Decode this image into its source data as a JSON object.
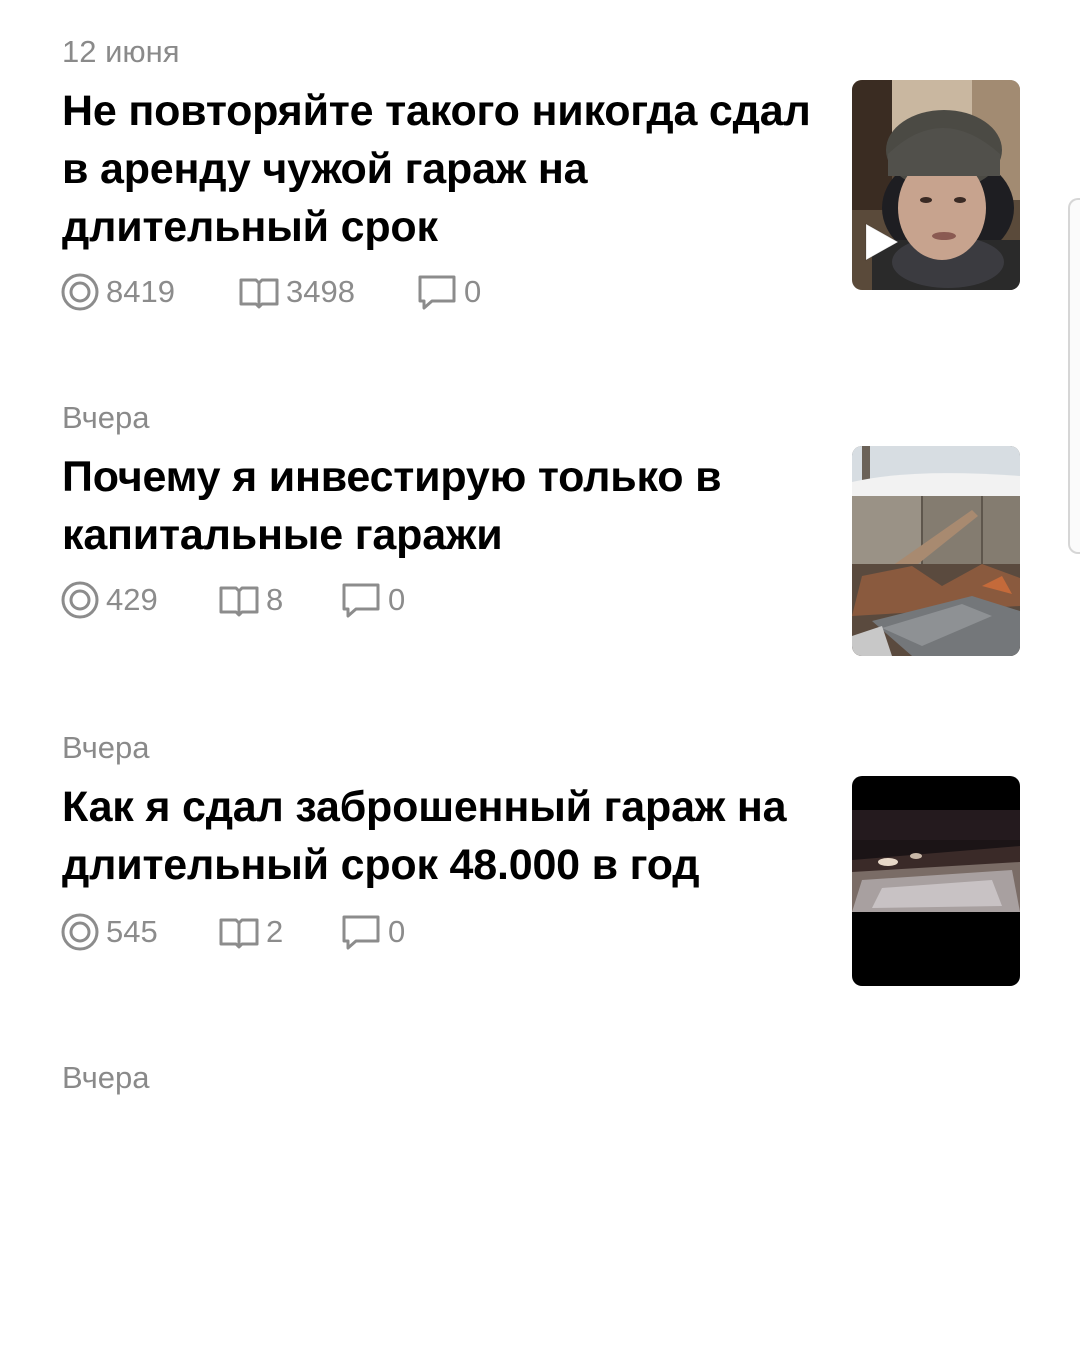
{
  "articles": [
    {
      "date": "12 июня",
      "title": "Не повторяйте такого никогда сдал в аренду чужой гараж на длительный срок",
      "views": "8419",
      "reads": "3498",
      "comments": "0",
      "thumbnail": "man-in-beanie-video",
      "is_video": true
    },
    {
      "date": "Вчера",
      "title": "Почему я инвестирую только в капитальные гаражи",
      "views": "429",
      "reads": "8",
      "comments": "0",
      "thumbnail": "destroyed-garage"
    },
    {
      "date": "Вчера",
      "title": "Как я сдал заброшенный гараж на длительный срок 48.000 в год",
      "views": "545",
      "reads": "2",
      "comments": "0",
      "thumbnail": "night-garage-headlights"
    },
    {
      "date": "Вчера"
    }
  ],
  "icons": {
    "views": "eye-target-icon",
    "reads": "open-book-icon",
    "comments": "speech-bubble-icon",
    "play": "play-icon"
  },
  "colors": {
    "meta_gray": "#8a8a8a",
    "title": "#000000",
    "background": "#ffffff"
  }
}
